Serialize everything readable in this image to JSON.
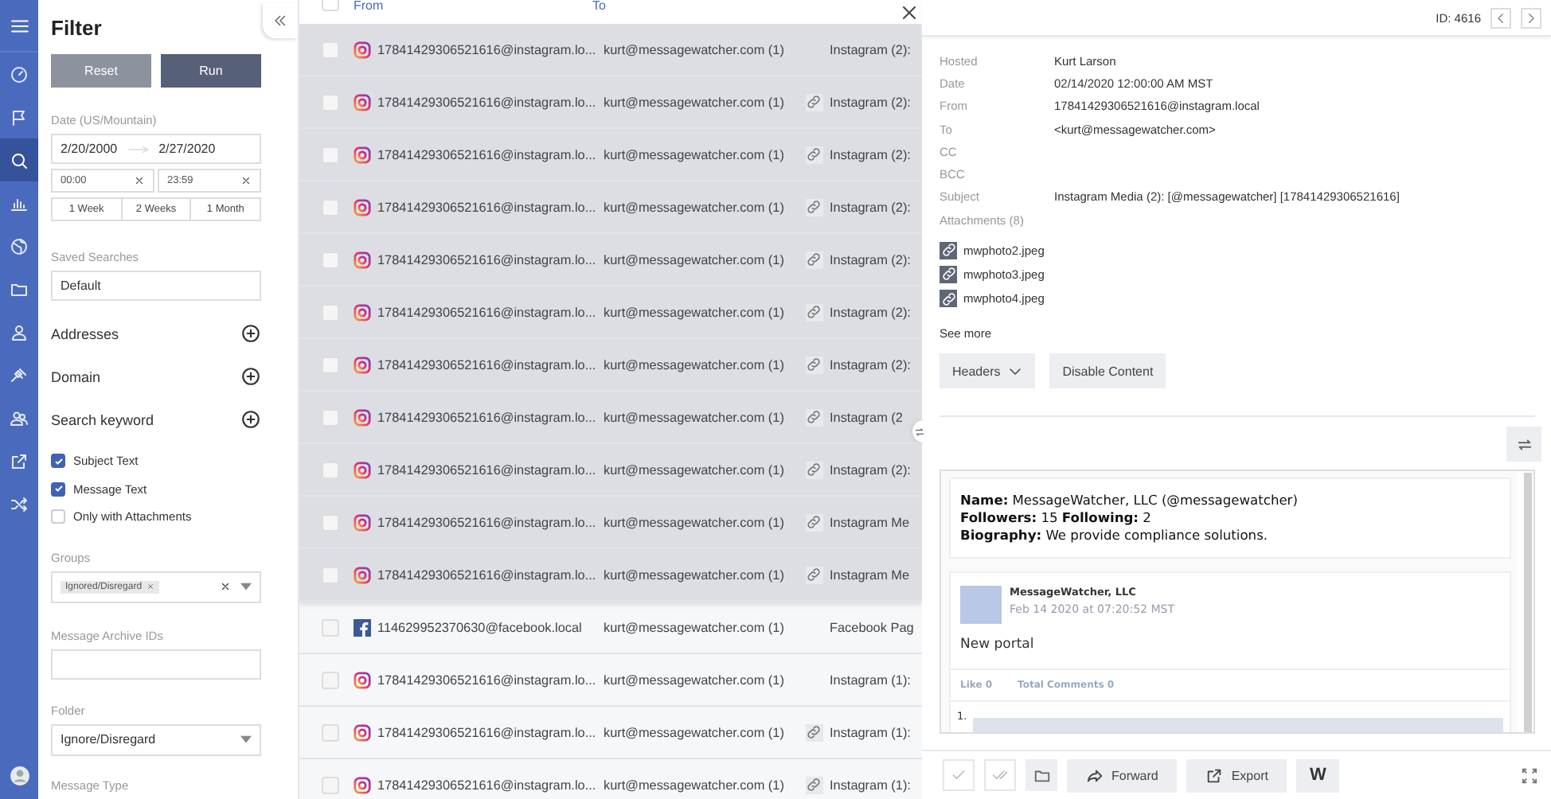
{
  "nav": {
    "items": [
      {
        "selected": false
      },
      {
        "selected": false
      },
      {
        "selected": true
      },
      {
        "selected": false
      },
      {
        "selected": false
      },
      {
        "selected": false
      },
      {
        "selected": false
      },
      {
        "selected": false
      },
      {
        "selected": false
      },
      {
        "selected": false
      },
      {
        "selected": false
      }
    ]
  },
  "filter": {
    "title": "Filter",
    "reset": "Reset",
    "run": "Run",
    "date_label": "Date (US/Mountain)",
    "date_from": "2/20/2000",
    "date_to": "2/27/2020",
    "time_from": "00:00",
    "time_to": "23:59",
    "ranges": [
      {
        "label": "1 Week",
        "selected": false
      },
      {
        "label": "2 Weeks",
        "selected": false
      },
      {
        "label": "1 Month",
        "selected": false
      }
    ],
    "saved_searches_label": "Saved Searches",
    "saved_search": "Default",
    "sections": [
      {
        "label": "Addresses"
      },
      {
        "label": "Domain"
      },
      {
        "label": "Search keyword"
      }
    ],
    "options": [
      {
        "label": "Subject Text",
        "checked": true
      },
      {
        "label": "Message Text",
        "checked": true
      },
      {
        "label": "Only with Attachments",
        "checked": false
      }
    ],
    "groups_label": "Groups",
    "group_tags": [
      "Ignored/Disregard"
    ],
    "archive_label": "Message Archive IDs",
    "folder_label": "Folder",
    "folder": "Ignore/Disregard",
    "message_type_label": "Message Type"
  },
  "list": {
    "columns": [
      "From",
      "To"
    ],
    "all_checked": false,
    "rows": [
      {
        "kind": "instagram",
        "from": "17841429306521616@instagram.lo...",
        "to": "kurt@messagewatcher.com  (1)",
        "attachment": false,
        "subject": "Instagram (2):",
        "selected": true
      },
      {
        "kind": "instagram",
        "from": "17841429306521616@instagram.lo...",
        "to": "kurt@messagewatcher.com  (1)",
        "attachment": true,
        "subject": "Instagram (2):",
        "selected": true
      },
      {
        "kind": "instagram",
        "from": "17841429306521616@instagram.lo...",
        "to": "kurt@messagewatcher.com  (1)",
        "attachment": true,
        "subject": "Instagram (2):",
        "selected": true
      },
      {
        "kind": "instagram",
        "from": "17841429306521616@instagram.lo...",
        "to": "kurt@messagewatcher.com  (1)",
        "attachment": true,
        "subject": "Instagram (2):",
        "selected": true
      },
      {
        "kind": "instagram",
        "from": "17841429306521616@instagram.lo...",
        "to": "kurt@messagewatcher.com  (1)",
        "attachment": true,
        "subject": "Instagram (2):",
        "selected": true
      },
      {
        "kind": "instagram",
        "from": "17841429306521616@instagram.lo...",
        "to": "kurt@messagewatcher.com  (1)",
        "attachment": true,
        "subject": "Instagram (2):",
        "selected": true
      },
      {
        "kind": "instagram",
        "from": "17841429306521616@instagram.lo...",
        "to": "kurt@messagewatcher.com  (1)",
        "attachment": true,
        "subject": "Instagram (2):",
        "selected": true
      },
      {
        "kind": "instagram",
        "from": "17841429306521616@instagram.lo...",
        "to": "kurt@messagewatcher.com  (1)",
        "attachment": true,
        "subject": "Instagram (2",
        "selected": true
      },
      {
        "kind": "instagram",
        "from": "17841429306521616@instagram.lo...",
        "to": "kurt@messagewatcher.com  (1)",
        "attachment": true,
        "subject": "Instagram (2):",
        "selected": true
      },
      {
        "kind": "instagram",
        "from": "17841429306521616@instagram.lo...",
        "to": "kurt@messagewatcher.com  (1)",
        "attachment": true,
        "subject": "Instagram Me",
        "selected": true
      },
      {
        "kind": "instagram",
        "from": "17841429306521616@instagram.lo...",
        "to": "kurt@messagewatcher.com  (1)",
        "attachment": true,
        "subject": "Instagram Me",
        "selected": true
      },
      {
        "kind": "facebook",
        "from": "114629952370630@facebook.local",
        "to": "kurt@messagewatcher.com  (1)",
        "attachment": false,
        "subject": "Facebook Pag",
        "selected": false
      },
      {
        "kind": "instagram",
        "from": "17841429306521616@instagram.lo...",
        "to": "kurt@messagewatcher.com  (1)",
        "attachment": false,
        "subject": "Instagram (1):",
        "selected": false
      },
      {
        "kind": "instagram",
        "from": "17841429306521616@instagram.lo...",
        "to": "kurt@messagewatcher.com  (1)",
        "attachment": true,
        "subject": "Instagram (1):",
        "selected": false
      },
      {
        "kind": "instagram",
        "from": "17841429306521616@instagram.lo...",
        "to": "kurt@messagewatcher.com  (1)",
        "attachment": true,
        "subject": "Instagram (1):",
        "selected": false
      }
    ]
  },
  "detail": {
    "id": "ID: 4616",
    "fields": [
      {
        "label": "Hosted",
        "value": "Kurt Larson"
      },
      {
        "label": "Date",
        "value": "02/14/2020 12:00:00 AM MST"
      },
      {
        "label": "From",
        "value": "17841429306521616@instagram.local"
      },
      {
        "label": "To",
        "value": "<kurt@messagewatcher.com>"
      },
      {
        "label": "CC"
      },
      {
        "label": "BCC"
      },
      {
        "label": "Subject",
        "value": "Instagram Media (2): [@messagewatcher] [17841429306521616]"
      }
    ],
    "attachments_label": "Attachments (8)",
    "attachments": [
      "mwphoto2.jpeg",
      "mwphoto3.jpeg",
      "mwphoto4.jpeg"
    ],
    "see_more": "See more",
    "headers_button": "Headers",
    "disable_button": "Disable Content",
    "preview": {
      "profile": [
        "**Name:** MessageWatcher, LLC (@messagewatcher)",
        "**Followers:** 15 **Following:** 2",
        "**Biography:** We provide compliance solutions."
      ],
      "post": {
        "author": "MessageWatcher, LLC",
        "time": "Feb 14 2020 at 07:20:52 MST",
        "text": "New portal",
        "likes": "Like 0",
        "comments": "Total Comments 0",
        "list_marker": "1."
      }
    },
    "toolbar": {
      "forward": "Forward",
      "export": "Export",
      "word": "W"
    }
  }
}
